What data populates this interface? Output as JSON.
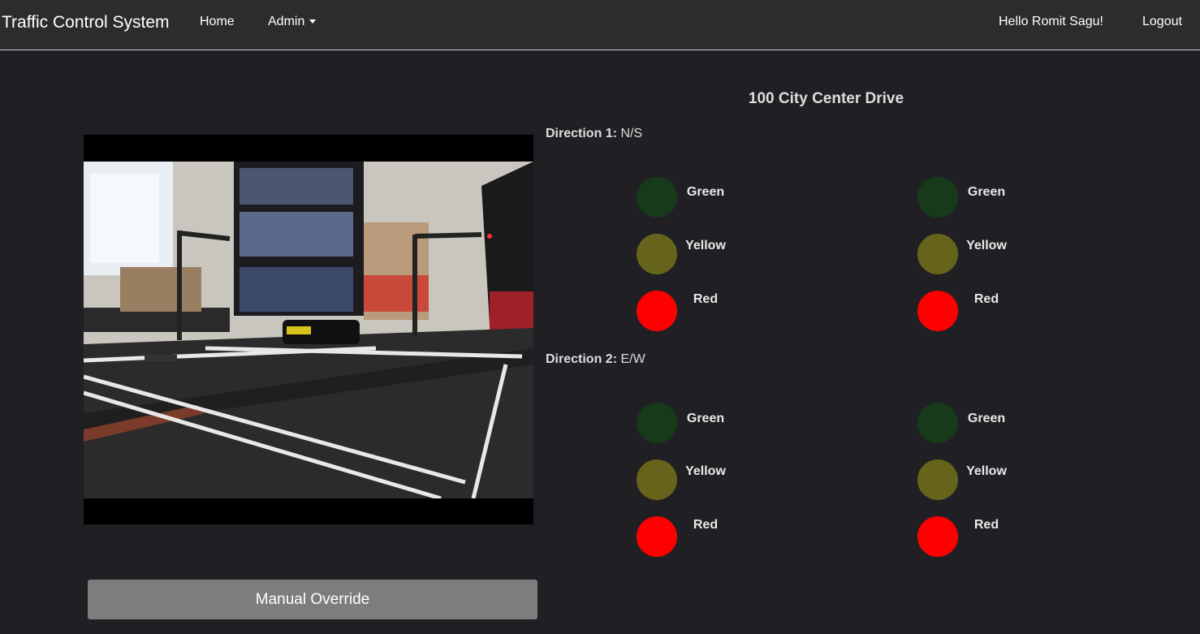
{
  "nav": {
    "brand": "Traffic Control System",
    "home": "Home",
    "admin": "Admin",
    "greeting": "Hello Romit Sagu!",
    "logout": "Logout"
  },
  "main": {
    "location": "100 City Center Drive",
    "override_label": "Manual Override",
    "directions": [
      {
        "label": "Direction 1:",
        "value": "N/S",
        "lights": [
          "Green",
          "Yellow",
          "Red"
        ]
      },
      {
        "label": "Direction 2:",
        "value": "E/W",
        "lights": [
          "Green",
          "Yellow",
          "Red"
        ]
      }
    ]
  },
  "colors": {
    "green_off": "#173a1a",
    "yellow_off": "#66631b",
    "red_on": "#ff0000",
    "background": "#202024",
    "navbar": "#2c2c2c"
  }
}
